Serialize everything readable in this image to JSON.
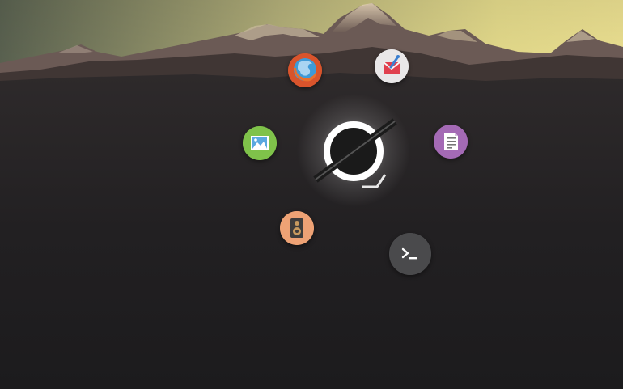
{
  "launcher": {
    "apps": [
      {
        "id": "firefox",
        "icon": "firefox-icon",
        "color": "#d9542c"
      },
      {
        "id": "mail",
        "icon": "mail-icon",
        "color": "#e9e7e8"
      },
      {
        "id": "image-viewer",
        "icon": "image-viewer-icon",
        "color": "#7fc24a"
      },
      {
        "id": "text-editor",
        "icon": "text-editor-icon",
        "color": "#a46ab5"
      },
      {
        "id": "music-player",
        "icon": "speaker-icon",
        "color": "#eea275"
      },
      {
        "id": "terminal",
        "icon": "terminal-icon",
        "color": "#4a4a4c"
      }
    ],
    "center_button": {
      "icon": "launcher-ring-icon",
      "color": "#ffffff"
    }
  },
  "wallpaper": {
    "sky_colors": [
      "#5b6350",
      "#d9d38a",
      "#f2e592"
    ],
    "ground_color": "#1f1d1f"
  }
}
